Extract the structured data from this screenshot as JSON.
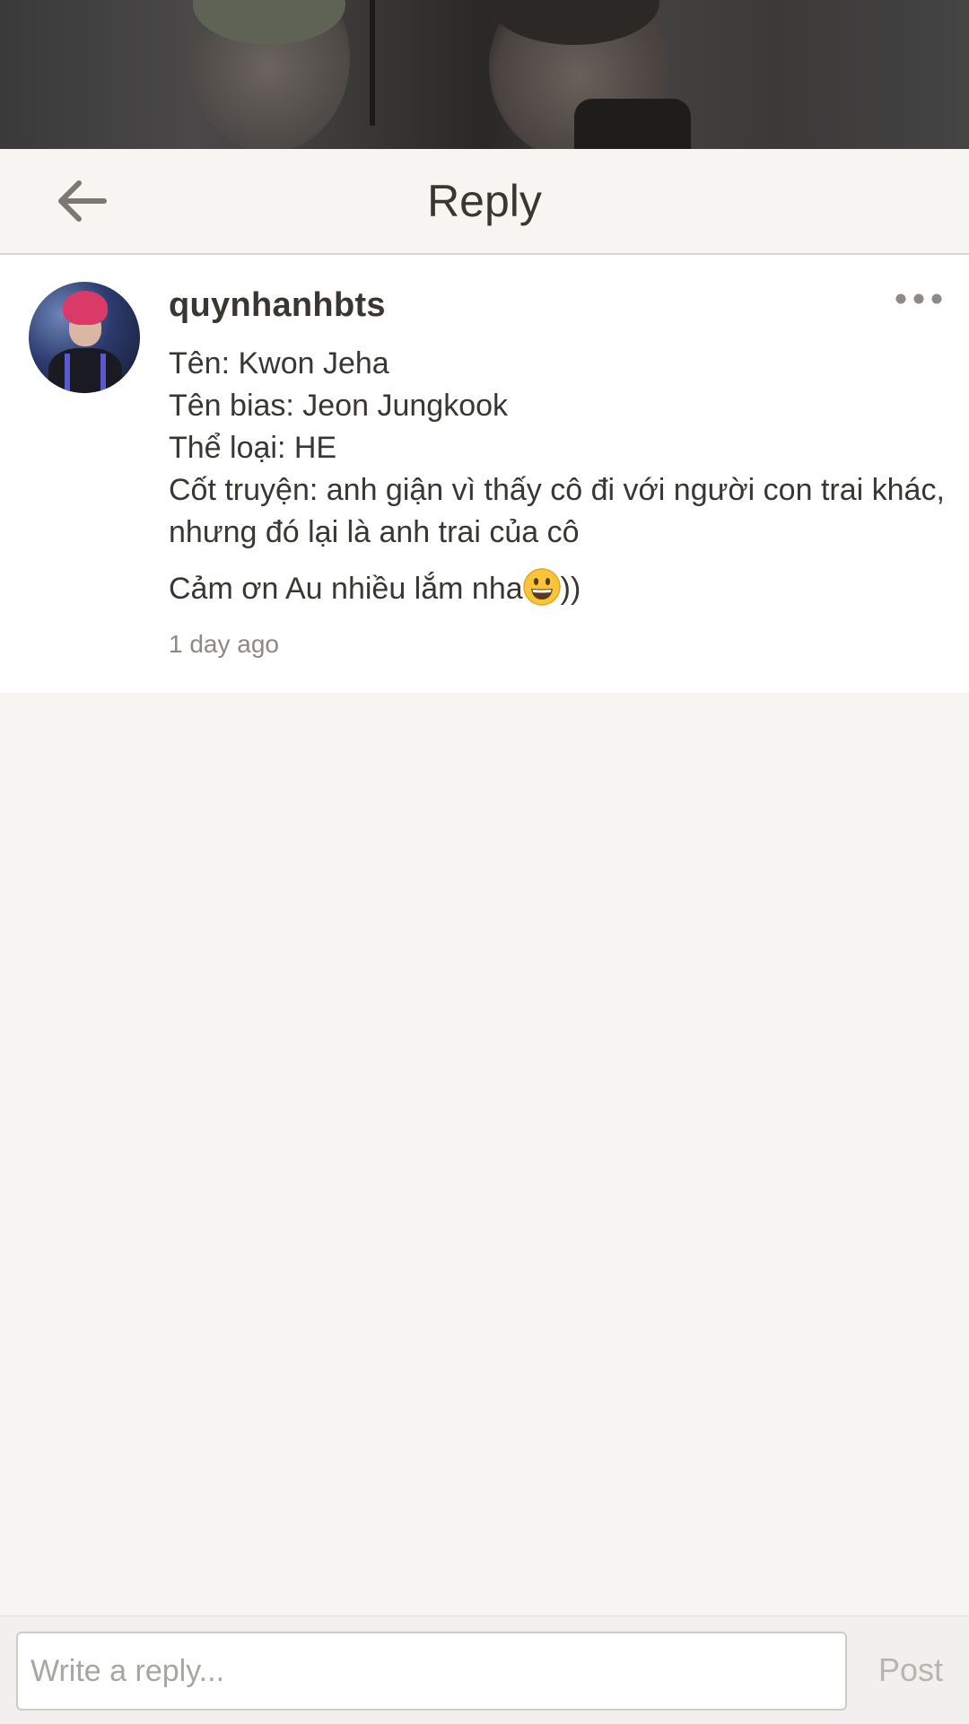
{
  "header": {
    "title": "Reply",
    "back_icon": "arrow-left-icon"
  },
  "comment": {
    "username": "quynhanhbts",
    "avatar": "avatar",
    "more_icon": "more-dots-icon",
    "lines": [
      "Tên: Kwon Jeha",
      "Tên bias: Jeon Jungkook",
      "Thể loại: HE",
      "Cốt truyện: anh giận vì thấy cô đi với người con trai khác,",
      "nhưng đó lại là anh trai của cô"
    ],
    "thanks_text": "Cảm ơn Au nhiều lắm nha",
    "thanks_suffix": "))",
    "emoji": "grinning-face-emoji",
    "timestamp": "1 day ago"
  },
  "composer": {
    "placeholder": "Write a reply...",
    "value": "",
    "post_label": "Post"
  },
  "colors": {
    "background": "#f6f5f1",
    "card": "#ffffff",
    "text": "#3a3632",
    "muted": "#8e8983",
    "post_disabled": "#b8b4ae"
  }
}
